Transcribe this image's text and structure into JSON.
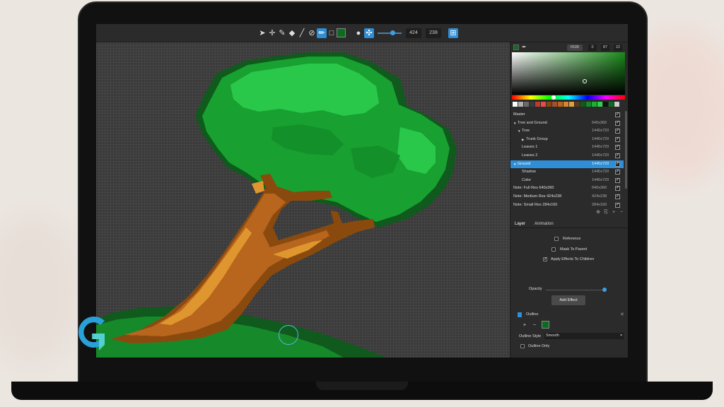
{
  "toolbar": {
    "tools": [
      {
        "icon": "cursor-icon",
        "glyph": "➤"
      },
      {
        "icon": "move-icon",
        "glyph": "✛"
      },
      {
        "icon": "brush-icon",
        "glyph": "✎"
      },
      {
        "icon": "eraser-icon",
        "glyph": "◆"
      },
      {
        "icon": "eyedropper-icon",
        "glyph": "╱"
      },
      {
        "icon": "no-fill-icon",
        "glyph": "⊘"
      },
      {
        "icon": "pencil-icon",
        "glyph": "✏"
      },
      {
        "icon": "rectangle-select-icon",
        "glyph": "□"
      }
    ],
    "primary_color": "#0b6b1e",
    "brush_shape_glyph": "●",
    "pixel_mode_glyph": "✣",
    "canvas_width": "424",
    "canvas_height": "238",
    "grid_glyph": "⊞"
  },
  "color_picker": {
    "current_color": "#0b6b1e",
    "mode": "RGB",
    "r": "0",
    "g": "87",
    "b": "22",
    "palette": [
      "#ffffff",
      "#b0b0b0",
      "#6a6a6a",
      "#3a3a3a",
      "#c0392b",
      "#e0504a",
      "#8b4513",
      "#a0522d",
      "#b8651e",
      "#d4892f",
      "#e0a040",
      "#5a3a1a",
      "#0f5a1c",
      "#168a2a",
      "#1fae36",
      "#2fd04a",
      "#111111",
      "#0b6b1e",
      "#cccccc"
    ]
  },
  "layers": [
    {
      "name": "Master",
      "res": "",
      "indent": 0,
      "arrow": "",
      "checked": true,
      "selected": false
    },
    {
      "name": "Tree and Ground",
      "res": "640x360",
      "indent": 0,
      "arrow": "▼",
      "checked": true,
      "selected": false
    },
    {
      "name": "Tree",
      "res": "1440x720",
      "indent": 1,
      "arrow": "▼",
      "checked": true,
      "selected": false
    },
    {
      "name": "Trunk Group",
      "res": "1440x720",
      "indent": 2,
      "arrow": "▶",
      "checked": true,
      "selected": false
    },
    {
      "name": "Leaves 1",
      "res": "1440x720",
      "indent": 2,
      "arrow": "",
      "checked": true,
      "selected": false
    },
    {
      "name": "Leaves 2",
      "res": "1440x720",
      "indent": 2,
      "arrow": "",
      "checked": true,
      "selected": false
    },
    {
      "name": "Ground",
      "res": "1440x720",
      "indent": 0,
      "arrow": "▼",
      "checked": true,
      "selected": true
    },
    {
      "name": "Shadow",
      "res": "1440x720",
      "indent": 2,
      "arrow": "",
      "checked": true,
      "selected": false
    },
    {
      "name": "Color",
      "res": "1440x720",
      "indent": 2,
      "arrow": "",
      "checked": true,
      "selected": false
    },
    {
      "name": "Note: Full Res 640x360",
      "res": "640x360",
      "indent": 0,
      "arrow": "",
      "checked": true,
      "selected": false
    },
    {
      "name": "Note: Medium Res 424x238",
      "res": "424x238",
      "indent": 0,
      "arrow": "",
      "checked": true,
      "selected": false
    },
    {
      "name": "Note: Small Res 284x160",
      "res": "284x160",
      "indent": 0,
      "arrow": "",
      "checked": true,
      "selected": false
    }
  ],
  "layer_buttons": [
    "⊕",
    "⎘",
    "+",
    "−"
  ],
  "tabs": {
    "layer": "Layer",
    "animation": "Animation"
  },
  "properties": {
    "reference": "Reference",
    "mask_to_parent": "Mask To Parent",
    "apply_effects": "Apply Effects To Children",
    "opacity_label": "Opacity",
    "opacity_value": 1.0,
    "add_effect": "Add Effect"
  },
  "effect": {
    "name": "Outline",
    "plus": "+",
    "minus": "−",
    "color": "#0b6b1e",
    "style_label": "Outline Style",
    "style_value": "Smooth",
    "outline_only": "Outline Only"
  },
  "logo": {
    "primary": "#2aa0d8",
    "secondary": "#5ad8d0"
  }
}
